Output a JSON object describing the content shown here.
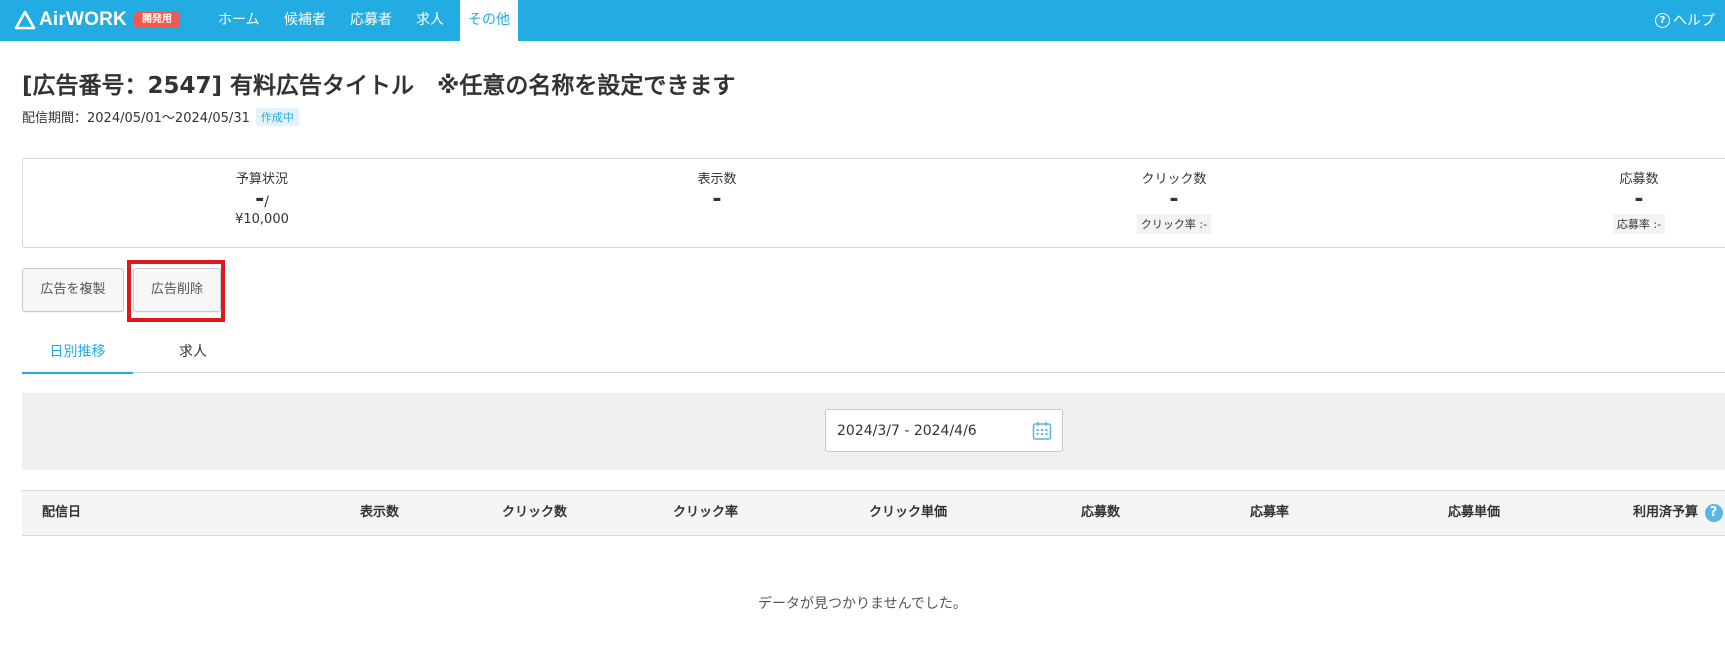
{
  "header": {
    "logo_text": "AirWORK",
    "badge": "開発用",
    "nav": [
      {
        "label": "ホーム"
      },
      {
        "label": "候補者"
      },
      {
        "label": "応募者"
      },
      {
        "label": "求人"
      },
      {
        "label": "その他"
      }
    ],
    "active_nav": "その他",
    "help": "ヘルプ"
  },
  "ad": {
    "title": "[広告番号：2547] 有料広告タイトル　※任意の名称を設定できます",
    "period": "配信期間：2024/05/01～2024/05/31",
    "status": "作成中"
  },
  "stats": {
    "budget": {
      "label": "予算状況",
      "used": "-",
      "separator": "/",
      "total": "¥10,000"
    },
    "impressions": {
      "label": "表示数",
      "value": "-"
    },
    "clicks": {
      "label": "クリック数",
      "value": "-",
      "rate": "クリック率 :-"
    },
    "applications": {
      "label": "応募数",
      "value": "-",
      "rate": "応募率 :-"
    }
  },
  "actions": {
    "duplicate": "広告を複製",
    "delete": "広告削除"
  },
  "tabs": [
    "日別推移",
    "求人"
  ],
  "filter": {
    "date_range": "2024/3/7 - 2024/4/6"
  },
  "table": {
    "columns": [
      "配信日",
      "表示数",
      "クリック数",
      "クリック率",
      "クリック単価",
      "応募数",
      "応募率",
      "応募単価",
      "利用済予算"
    ],
    "empty_message": "データが見つかりませんでした。"
  },
  "colors": {
    "brand": "#22ace2",
    "dev_badge": "#ef5a4e",
    "highlight": "#e0171d"
  }
}
